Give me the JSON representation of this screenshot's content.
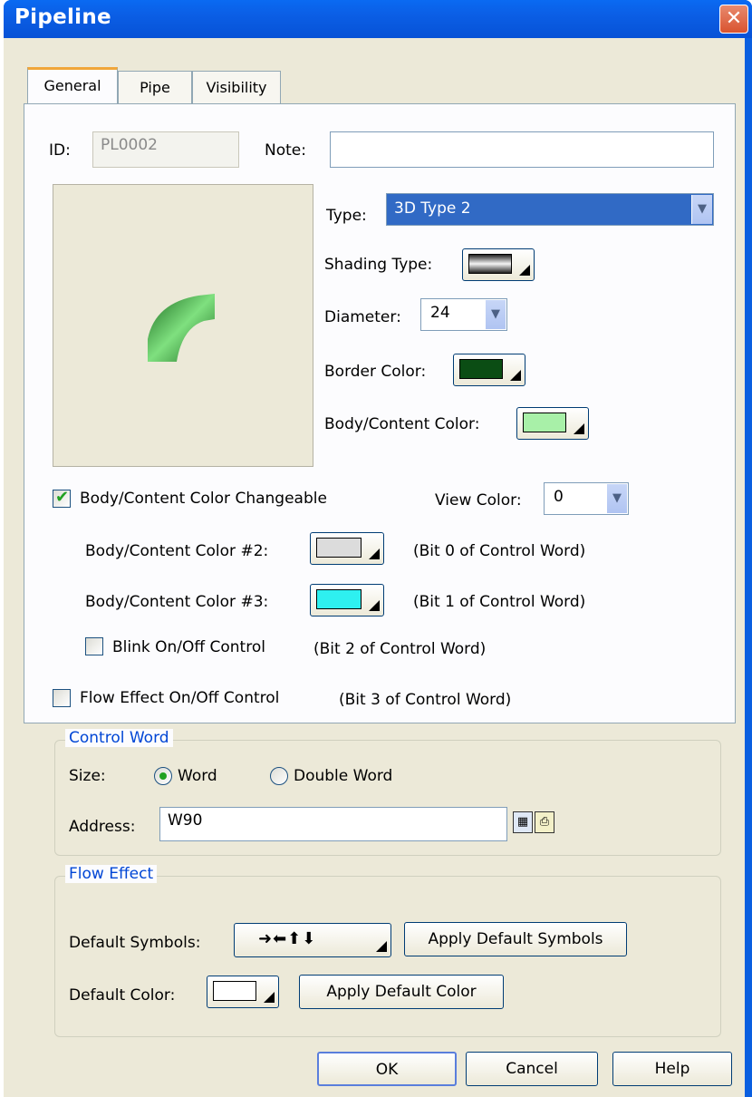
{
  "window": {
    "title": "Pipeline",
    "close_glyph": "✕"
  },
  "tabs": [
    {
      "label": "General",
      "active": true
    },
    {
      "label": "Pipe",
      "active": false
    },
    {
      "label": "Visibility",
      "active": false
    }
  ],
  "general": {
    "id_label": "ID:",
    "id_value": "PL0002",
    "note_label": "Note:",
    "note_value": "",
    "type_label": "Type:",
    "type_value": "3D Type 2",
    "shading_label": "Shading Type:",
    "diameter_label": "Diameter:",
    "diameter_value": "24",
    "border_color_label": "Border Color:",
    "border_color": "#0b4d14",
    "body_color_label": "Body/Content Color:",
    "body_color": "#a8f0a8",
    "changeable_label": "Body/Content Color Changeable",
    "changeable_checked": true,
    "view_color_label": "View Color:",
    "view_color_value": "0",
    "color2_label": "Body/Content Color #2:",
    "color2": "#dcdcdc",
    "color2_note": "(Bit 0 of Control Word)",
    "color3_label": "Body/Content Color #3:",
    "color3": "#2ef0f0",
    "color3_note": "(Bit 1 of Control Word)",
    "blink_label": "Blink On/Off Control",
    "blink_checked": false,
    "blink_note": "(Bit 2 of Control Word)",
    "flow_label": "Flow Effect On/Off Control",
    "flow_checked": false,
    "flow_note": "(Bit 3 of Control Word)"
  },
  "control_word": {
    "title": "Control Word",
    "size_label": "Size:",
    "word_label": "Word",
    "dword_label": "Double Word",
    "selected": "Word",
    "address_label": "Address:",
    "address_value": "W90"
  },
  "flow_effect": {
    "title": "Flow Effect",
    "symbols_label": "Default Symbols:",
    "symbols_glyphs": "➜⬅⬆⬇",
    "apply_symbols": "Apply Default Symbols",
    "color_label": "Default Color:",
    "default_color": "#ffffff",
    "apply_color": "Apply Default Color"
  },
  "footer": {
    "ok": "OK",
    "cancel": "Cancel",
    "help": "Help"
  },
  "colors": {
    "titlebar": "#0a5fe0",
    "dialog_bg": "#ece9d8",
    "type_selected_bg": "#316ac5"
  }
}
